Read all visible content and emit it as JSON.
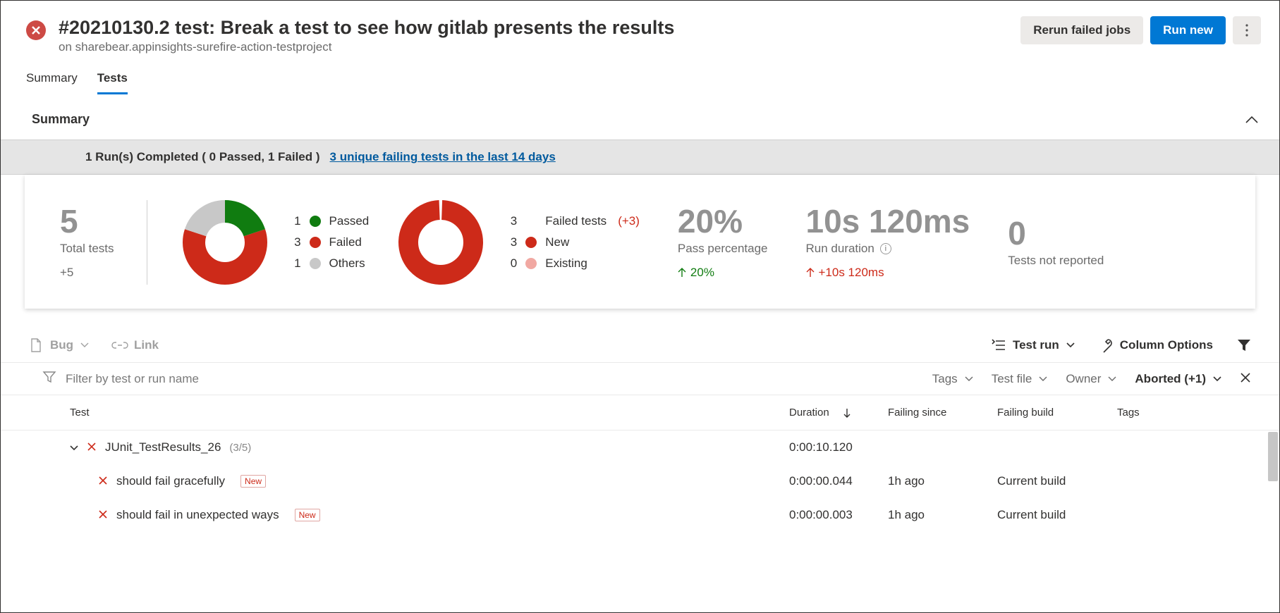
{
  "header": {
    "title": "#20210130.2 test: Break a test to see how gitlab presents the results",
    "subtitle": "on sharebear.appinsights-surefire-action-testproject",
    "rerun_label": "Rerun failed jobs",
    "run_label": "Run new"
  },
  "tabs": {
    "summary": "Summary",
    "tests": "Tests"
  },
  "section": {
    "summary_title": "Summary"
  },
  "banner": {
    "text": "1 Run(s) Completed ( 0 Passed, 1 Failed )",
    "link": "3 unique failing tests in the last 14 days"
  },
  "metrics": {
    "total": {
      "value": "5",
      "label": "Total tests",
      "delta": "+5"
    },
    "breakdown": {
      "passed": {
        "n": "1",
        "label": "Passed"
      },
      "failed": {
        "n": "3",
        "label": "Failed"
      },
      "others": {
        "n": "1",
        "label": "Others"
      }
    },
    "failed_tests": {
      "total": {
        "n": "3",
        "label": "Failed tests",
        "delta": "(+3)"
      },
      "new": {
        "n": "3",
        "label": "New"
      },
      "existing": {
        "n": "0",
        "label": "Existing"
      }
    },
    "pass_pct": {
      "value": "20%",
      "label": "Pass percentage",
      "trend": "20%"
    },
    "duration": {
      "value": "10s 120ms",
      "label": "Run duration",
      "trend": "+10s 120ms"
    },
    "not_reported": {
      "value": "0",
      "label": "Tests not reported"
    }
  },
  "toolbar": {
    "bug": "Bug",
    "link": "Link",
    "test_run": "Test run",
    "column_options": "Column Options"
  },
  "filter": {
    "placeholder": "Filter by test or run name",
    "tags": "Tags",
    "test_file": "Test file",
    "owner": "Owner",
    "aborted": "Aborted (+1)"
  },
  "columns": {
    "test": "Test",
    "duration": "Duration",
    "since": "Failing since",
    "build": "Failing build",
    "tags": "Tags"
  },
  "rows": {
    "group": {
      "name": "JUnit_TestResults_26",
      "count": "(3/5)",
      "duration": "0:00:10.120"
    },
    "r1": {
      "name": "should fail gracefully",
      "badge": "New",
      "duration": "0:00:00.044",
      "since": "1h ago",
      "build": "Current build"
    },
    "r2": {
      "name": "should fail in unexpected ways",
      "badge": "New",
      "duration": "0:00:00.003",
      "since": "1h ago",
      "build": "Current build"
    }
  },
  "chart_data": [
    {
      "type": "pie",
      "title": "Test breakdown",
      "series": [
        {
          "name": "Passed",
          "value": 1,
          "color": "#107c10"
        },
        {
          "name": "Failed",
          "value": 3,
          "color": "#cd2a19"
        },
        {
          "name": "Others",
          "value": 1,
          "color": "#c8c8c8"
        }
      ]
    },
    {
      "type": "pie",
      "title": "Failed tests",
      "total": 3,
      "delta": "+3",
      "series": [
        {
          "name": "New",
          "value": 3,
          "color": "#cd2a19"
        },
        {
          "name": "Existing",
          "value": 0,
          "color": "#f1a8a2"
        }
      ]
    }
  ]
}
